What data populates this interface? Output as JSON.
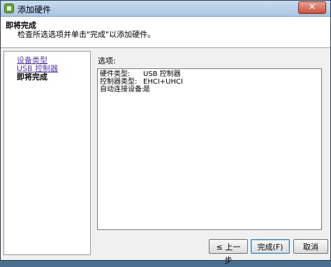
{
  "window": {
    "title": "添加硬件",
    "close_symbol": "✕"
  },
  "header": {
    "title": "即将完成",
    "description": "检查所选选项并单击\"完成\"以添加硬件。"
  },
  "nav": {
    "items": [
      {
        "label": "设备类型",
        "state": "link"
      },
      {
        "label": "USB 控制器",
        "state": "link"
      },
      {
        "label": "即将完成",
        "state": "current"
      }
    ]
  },
  "options": {
    "label": "选项:",
    "rows": [
      {
        "key": "硬件类型:",
        "value": "USB 控制器"
      },
      {
        "key": "控制器类型:",
        "value": "EHCI+UHCI"
      },
      {
        "key": "自动连接设备:",
        "value": "是"
      }
    ]
  },
  "buttons": {
    "back": "≤ 上一步",
    "finish": "完成(F)",
    "cancel": "取消"
  },
  "colors": {
    "link": "#5a3db8",
    "close_button": "#c9503a",
    "titlebar": "#b8d1ea"
  }
}
